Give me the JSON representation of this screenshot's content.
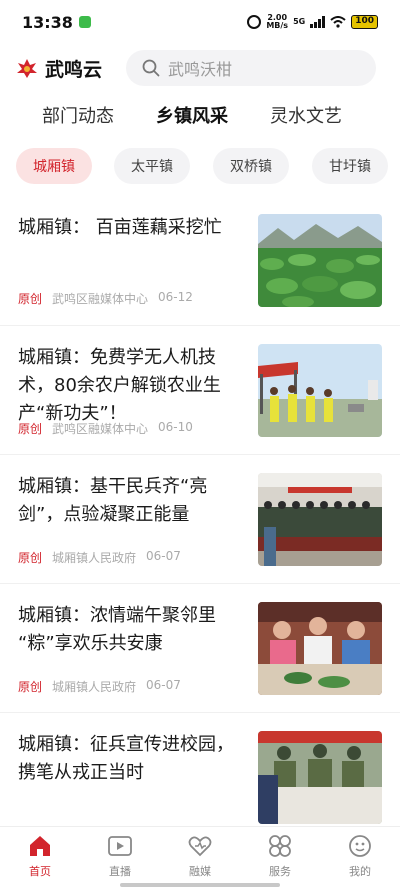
{
  "status_bar": {
    "time": "13:38",
    "net_speed_value": "2.00",
    "net_speed_unit": "MB/s",
    "network": "5G",
    "battery": "100"
  },
  "header": {
    "app_name": "武鸣云",
    "search_placeholder": "武鸣沃柑",
    "logo_color": "#d2242c"
  },
  "main_tabs": [
    {
      "label": "部门动态",
      "active": false
    },
    {
      "label": "乡镇风采",
      "active": true
    },
    {
      "label": "灵水文艺",
      "active": false
    }
  ],
  "town_chips": [
    {
      "label": "城厢镇",
      "active": true
    },
    {
      "label": "太平镇",
      "active": false
    },
    {
      "label": "双桥镇",
      "active": false
    },
    {
      "label": "甘圩镇",
      "active": false
    }
  ],
  "news": [
    {
      "title": "城厢镇： 百亩莲藕采挖忙",
      "tag": "原创",
      "source": "武鸣区融媒体中心",
      "date": "06-12",
      "thumb": "lotus-field"
    },
    {
      "title": "城厢镇：免费学无人机技术，80余农户解锁农业生产“新功夫”！",
      "tag": "原创",
      "source": "武鸣区融媒体中心",
      "date": "06-10",
      "thumb": "drone-training"
    },
    {
      "title": "城厢镇：基干民兵齐“亮剑”，点验凝聚正能量",
      "tag": "原创",
      "source": "城厢镇人民政府",
      "date": "06-07",
      "thumb": "militia-assembly"
    },
    {
      "title": "城厢镇：浓情端午聚邻里 “粽”享欢乐共安康",
      "tag": "原创",
      "source": "城厢镇人民政府",
      "date": "06-07",
      "thumb": "zongzi-making"
    },
    {
      "title": "城厢镇：征兵宣传进校园，携笔从戎正当时",
      "tag": "",
      "source": "",
      "date": "",
      "thumb": "recruitment-campus"
    }
  ],
  "bottom_nav": [
    {
      "label": "首页",
      "icon": "home-icon",
      "active": true
    },
    {
      "label": "直播",
      "icon": "play-icon",
      "active": false
    },
    {
      "label": "融媒",
      "icon": "heart-icon",
      "active": false
    },
    {
      "label": "服务",
      "icon": "grid-icon",
      "active": false
    },
    {
      "label": "我的",
      "icon": "profile-icon",
      "active": false
    }
  ],
  "colors": {
    "accent": "#d2242c",
    "chip_active_bg": "#fbe2e2",
    "chip_bg": "#f3f3f5"
  }
}
